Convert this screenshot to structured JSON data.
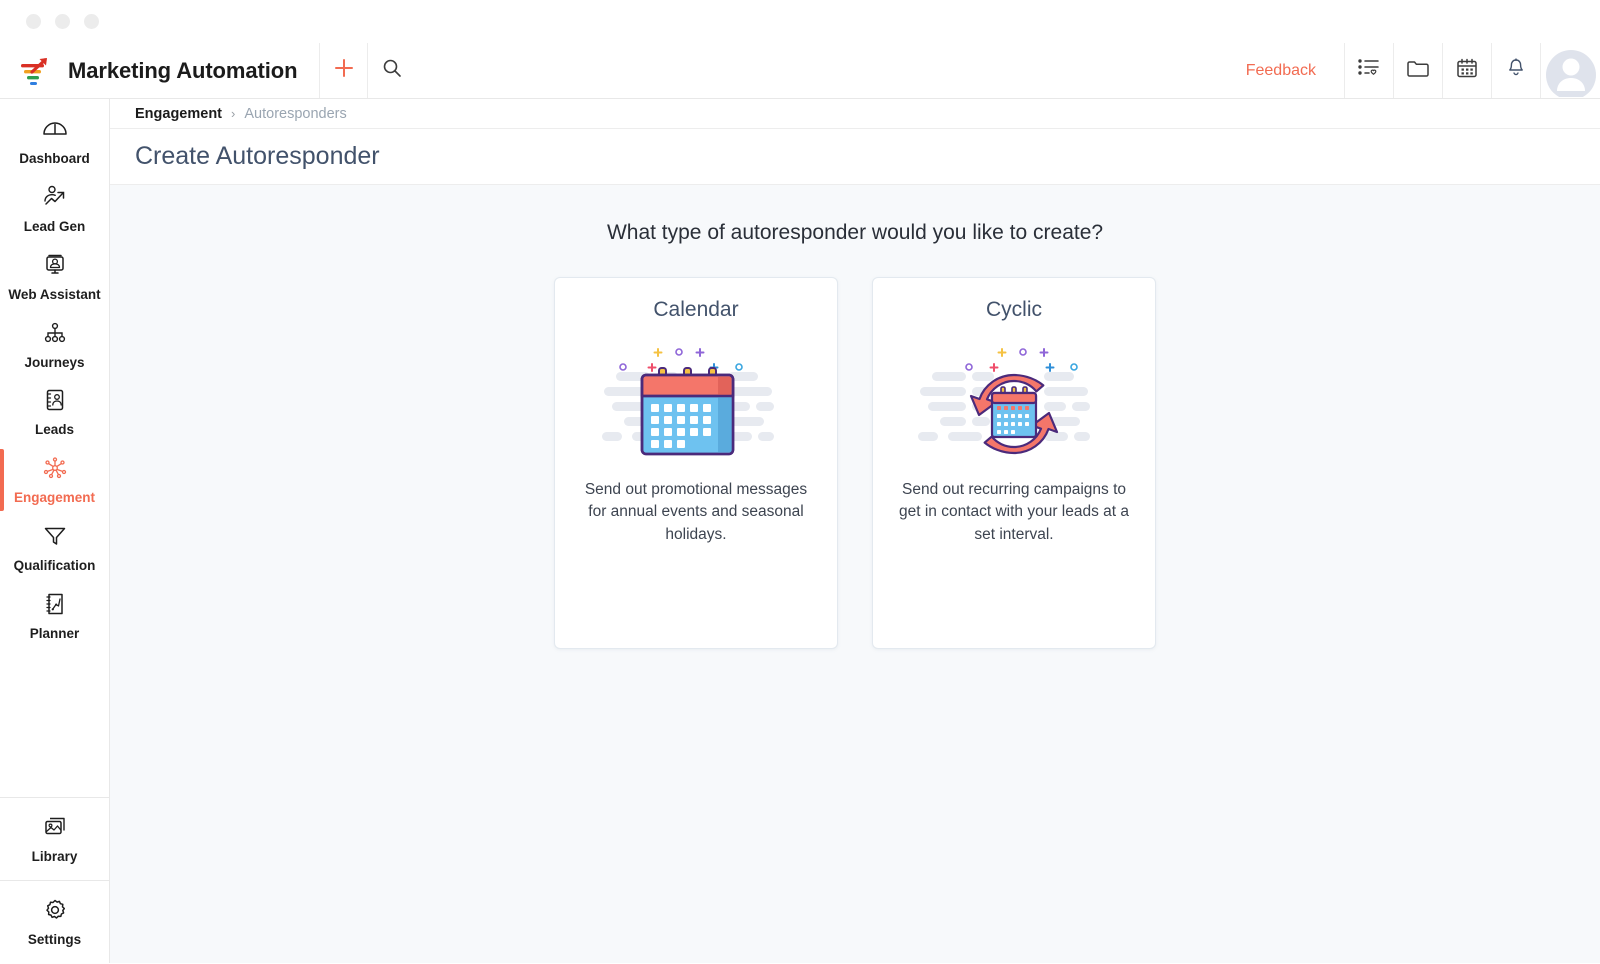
{
  "window": {
    "dots": [
      "window-dot-1",
      "window-dot-2",
      "window-dot-3"
    ]
  },
  "topbar": {
    "app_title": "Marketing Automation",
    "logo_icon": "marketing-automation-logo",
    "add_label": "+",
    "add_icon": "plus-icon",
    "search_icon": "search-icon",
    "feedback_label": "Feedback",
    "icons": [
      {
        "name": "list-favorites-icon",
        "label": "List with heart"
      },
      {
        "name": "folder-icon",
        "label": "Folder"
      },
      {
        "name": "calendar-icon",
        "label": "Calendar"
      },
      {
        "name": "bell-icon",
        "label": "Notifications"
      }
    ],
    "avatar": "user-avatar",
    "accent_color": "#f26b51"
  },
  "sidebar": {
    "items": [
      {
        "label": "Dashboard",
        "icon": "gauge-icon",
        "active": false
      },
      {
        "label": "Lead Gen",
        "icon": "lead-gen-icon",
        "active": false
      },
      {
        "label": "Web Assistant",
        "icon": "web-assistant-icon",
        "active": false
      },
      {
        "label": "Journeys",
        "icon": "journeys-icon",
        "active": false
      },
      {
        "label": "Leads",
        "icon": "leads-icon",
        "active": false
      },
      {
        "label": "Engagement",
        "icon": "engagement-icon",
        "active": true
      },
      {
        "label": "Qualification",
        "icon": "funnel-icon",
        "active": false
      },
      {
        "label": "Planner",
        "icon": "planner-icon",
        "active": false
      }
    ],
    "bottom_items": [
      {
        "label": "Library",
        "icon": "library-icon"
      },
      {
        "label": "Settings",
        "icon": "gear-icon"
      }
    ],
    "active_color": "#f26b51"
  },
  "breadcrumb": {
    "current": "Engagement",
    "separator": "›",
    "trail": "Autoresponders"
  },
  "page": {
    "title": "Create Autoresponder"
  },
  "main": {
    "prompt": "What type of autoresponder would you like to create?",
    "cards": [
      {
        "title": "Calendar",
        "illustration": "calendar-illustration",
        "description": "Send out promotional messages for annual events and seasonal holidays."
      },
      {
        "title": "Cyclic",
        "illustration": "cyclic-calendar-illustration",
        "description": "Send out recurring campaigns to get in contact with your leads at a set interval."
      }
    ]
  },
  "colors": {
    "accent": "#f26b51",
    "card_border": "#e3e9ef",
    "content_bg": "#f7f9fb",
    "heading": "#42526b",
    "illus_blue": "#6ec2f0",
    "illus_red": "#f4766a",
    "illus_purple": "#4b2a7b",
    "illus_gray": "#e6e9ef"
  }
}
